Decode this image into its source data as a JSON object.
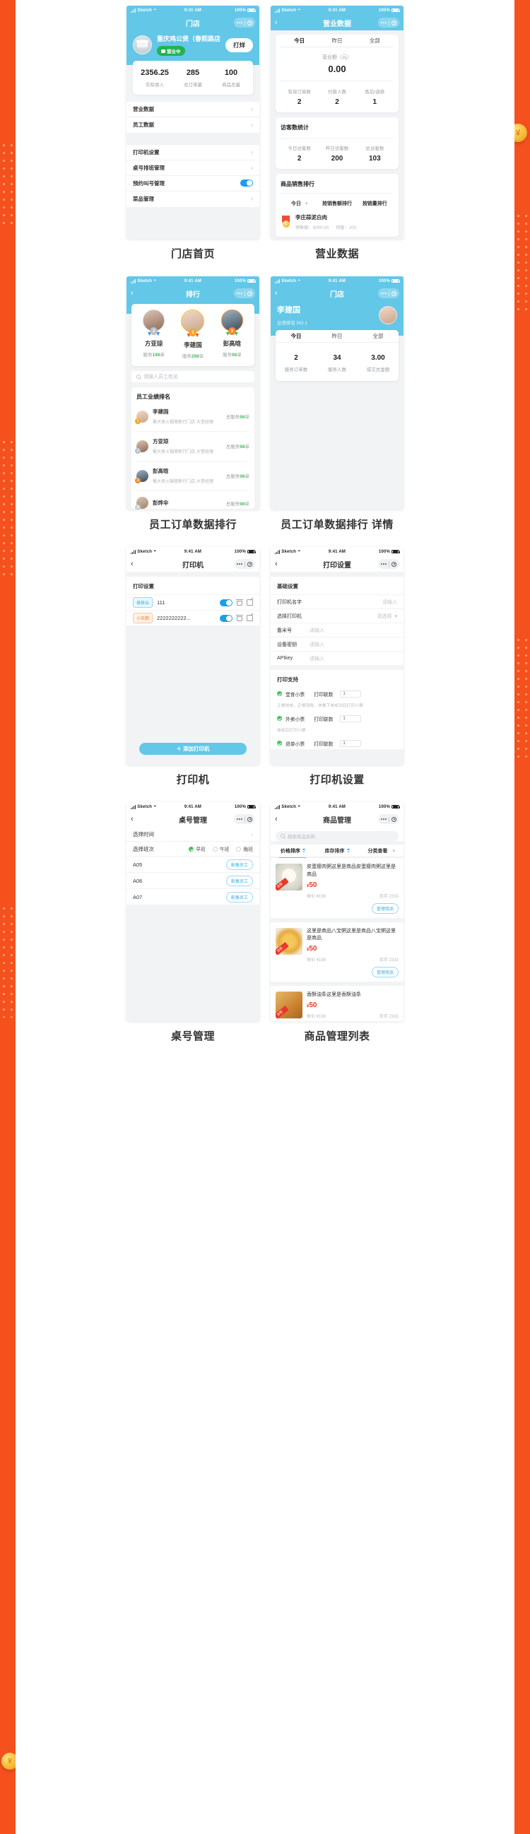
{
  "status_bar": {
    "carrier": "Sketch",
    "time": "9:41 AM",
    "battery": "100%"
  },
  "captions": {
    "c1": "门店首页",
    "c2": "营业数据",
    "c3": "员工订单数据排行",
    "c4": "员工订单数据排行 详情",
    "c5": "打印机",
    "c6": "打印机设置",
    "c7": "桌号管理",
    "c8": "商品管理列表"
  },
  "screen_store_home": {
    "nav_title": "门店",
    "store_name": "重庆鸡公煲（春熙路店）",
    "status_badge": "营业中",
    "close_button": "打烊",
    "stats": [
      {
        "value": "2356.25",
        "label": "实际收入"
      },
      {
        "value": "285",
        "label": "总订单量"
      },
      {
        "value": "100",
        "label": "商品总量"
      }
    ],
    "menu_group_1": [
      {
        "label": "营业数据",
        "type": "chevron"
      },
      {
        "label": "员工数据",
        "type": "chevron"
      }
    ],
    "menu_group_2": [
      {
        "label": "打印机设置",
        "type": "chevron"
      },
      {
        "label": "桌号排班管理",
        "type": "chevron"
      },
      {
        "label": "预约叫号管理",
        "type": "switch",
        "on": true
      },
      {
        "label": "菜品管理",
        "type": "chevron"
      }
    ]
  },
  "screen_business_data": {
    "nav_title": "营业数据",
    "tabs": [
      "今日",
      "昨日",
      "全部"
    ],
    "active_tab": "今日",
    "turnover_label": "营业额（元）",
    "turnover_value": "0.00",
    "order_stats": [
      {
        "label": "有效订单数",
        "value": "2"
      },
      {
        "label": "付款人数",
        "value": "2"
      },
      {
        "label": "售后/退款",
        "value": "1"
      }
    ],
    "visitor_title": "访客数统计",
    "visitor_stats": [
      {
        "label": "今日访客数",
        "value": "2"
      },
      {
        "label": "昨日访客数",
        "value": "200"
      },
      {
        "label": "总访客数",
        "value": "103"
      }
    ],
    "sales_rank_title": "商品销售排行",
    "rank_filters": [
      "今日",
      "按销售额排行",
      "按销量排行"
    ],
    "rank_items": [
      {
        "rank": "1",
        "name": "李庄蒜泥白肉",
        "amount": "销售额：9000.00",
        "count": "销量：200"
      }
    ]
  },
  "screen_ranking": {
    "nav_title": "排行",
    "podium": [
      {
        "rank": "2",
        "name": "方亚琼",
        "prefix": "服务",
        "count": "198",
        "suffix": "单"
      },
      {
        "rank": "1",
        "name": "李建国",
        "prefix": "服务",
        "count": "298",
        "suffix": "单"
      },
      {
        "rank": "3",
        "name": "彭高晗",
        "prefix": "服务",
        "count": "98",
        "suffix": "单"
      }
    ],
    "search_placeholder": "请输入员工姓名",
    "list_title": "员工业绩排名",
    "employees": [
      {
        "rank": "1",
        "name": "李建国",
        "dept": "蜀大侠火锅莲新行门店·大堂经理",
        "prefix": "总服务",
        "count": "98",
        "suffix": "单"
      },
      {
        "rank": "2",
        "name": "方亚琼",
        "dept": "蜀大侠火锅莲新行门店·大堂经理",
        "prefix": "总服务",
        "count": "98",
        "suffix": "单"
      },
      {
        "rank": "3",
        "name": "彭高晗",
        "dept": "蜀大侠火锅莲新行门店·大堂经理",
        "prefix": "总服务",
        "count": "98",
        "suffix": "单"
      },
      {
        "rank": "4",
        "name": "彭烨伞",
        "dept": "蜀大侠火锅莲新行门店·大堂经理",
        "prefix": "总服务",
        "count": "98",
        "suffix": "单"
      }
    ]
  },
  "screen_staff_detail": {
    "nav_title": "门店",
    "user_name": "李建国",
    "user_rank": "业绩排名 NO.1",
    "tabs": [
      "今日",
      "昨日",
      "全部"
    ],
    "active_tab": "今日",
    "stats": [
      {
        "value": "2",
        "label": "服务订单数"
      },
      {
        "value": "34",
        "label": "服务人数"
      },
      {
        "value": "3.00",
        "label": "成交总金额"
      }
    ]
  },
  "screen_printer": {
    "nav_title": "打印机",
    "section_title": "打印设置",
    "printers": [
      {
        "tag": "易联云",
        "name": "111",
        "on": false
      },
      {
        "tag": "小天鹅",
        "name": "2222222222...",
        "on": true
      }
    ],
    "add_button": "＋ 添加打印机"
  },
  "screen_printer_settings": {
    "nav_title": "打印设置",
    "basic_title": "基础设置",
    "fields": [
      {
        "label": "打印机名字",
        "value": "请输入",
        "widget": "text"
      },
      {
        "label": "选择打印机",
        "value": "请选择",
        "widget": "select"
      },
      {
        "label": "备米号",
        "value": "请输入",
        "widget": "text"
      },
      {
        "label": "设备密钥",
        "value": "请输入",
        "widget": "text"
      },
      {
        "label": "APIkey",
        "value": "请输入",
        "widget": "text"
      }
    ],
    "support_title": "打印支持",
    "support": [
      {
        "name": "堂食小票",
        "count_label": "打印联数",
        "count": "1",
        "note": "正餐排单、正餐锁账、快餐下单成功后打印小票"
      },
      {
        "name": "外卖小票",
        "count_label": "打印联数",
        "count": "1",
        "note": "接单后打印小票"
      },
      {
        "name": "退单小票",
        "count_label": "打印联数",
        "count": "1",
        "note": ""
      }
    ]
  },
  "screen_table_mgmt": {
    "nav_title": "桌号管理",
    "pick_time_label": "选择时间",
    "pick_shift_label": "选择班次",
    "shifts": [
      {
        "label": "早班",
        "on": true
      },
      {
        "label": "午班",
        "on": false
      },
      {
        "label": "晚班",
        "on": false
      }
    ],
    "tables": [
      {
        "code": "A05",
        "action": "配备员工"
      },
      {
        "code": "A06",
        "action": "配备员工"
      },
      {
        "code": "A07",
        "action": "配备员工"
      }
    ]
  },
  "screen_goods": {
    "nav_title": "商品管理",
    "search_placeholder": "搜索商品名称",
    "sorts": [
      {
        "label": "价格排序",
        "active": true
      },
      {
        "label": "库存排序",
        "active": false
      },
      {
        "label": "分类查看",
        "active": false
      }
    ],
    "manage_label": "管理商品",
    "items": [
      {
        "name": "皮蛋瘦肉粥这里是商品皮蛋瘦肉粥这里是商品",
        "price": "50",
        "currency": "¥",
        "original": "原价 ¥199",
        "stock": "库存 2333",
        "flag": "自营"
      },
      {
        "name": "这里是商品八宝粥这里是商品八宝粥这里是商品",
        "price": "50",
        "currency": "¥",
        "original": "原价 ¥199",
        "stock": "库存 2333",
        "flag": "自营"
      },
      {
        "name": "香酥油条这里是香酥油条",
        "price": "50",
        "currency": "¥",
        "original": "原价 ¥199",
        "stock": "库存 2333",
        "flag": "自营"
      }
    ]
  }
}
